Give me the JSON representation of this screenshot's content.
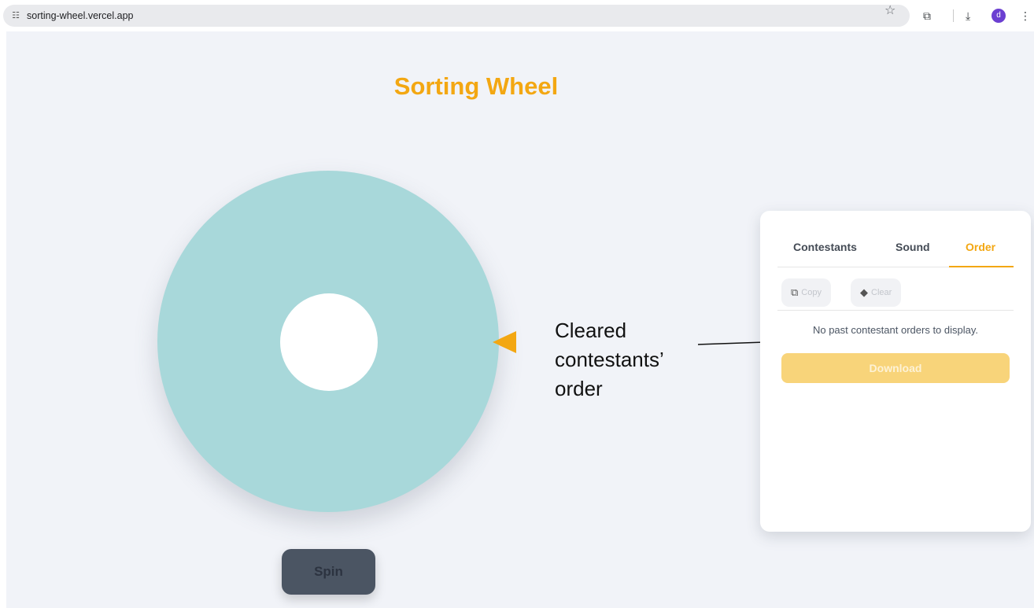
{
  "browser": {
    "url": "sorting-wheel.vercel.app",
    "avatar_letter": "d"
  },
  "page": {
    "title": "Sorting Wheel",
    "spin_label": "Spin",
    "annotation": "Cleared contestants’ order"
  },
  "panel": {
    "tabs": [
      "Contestants",
      "Sound",
      "Order"
    ],
    "active_tab": "Order",
    "copy_label": "Copy",
    "clear_label": "Clear",
    "empty_message": "No past contestant orders to display.",
    "download_label": "Download"
  },
  "colors": {
    "accent": "#f3a712",
    "wheel": "#a8d8da",
    "spin_button": "#4b5563",
    "download_button": "#f8d47a",
    "page_bg": "#f1f3f8"
  },
  "icons": {
    "site": "site-settings-icon",
    "star": "bookmark-star-icon",
    "lens": "google-lens-icon",
    "download": "download-icon",
    "menu": "kebab-menu-icon",
    "copy": "copy-icon",
    "clear": "eraser-icon"
  }
}
